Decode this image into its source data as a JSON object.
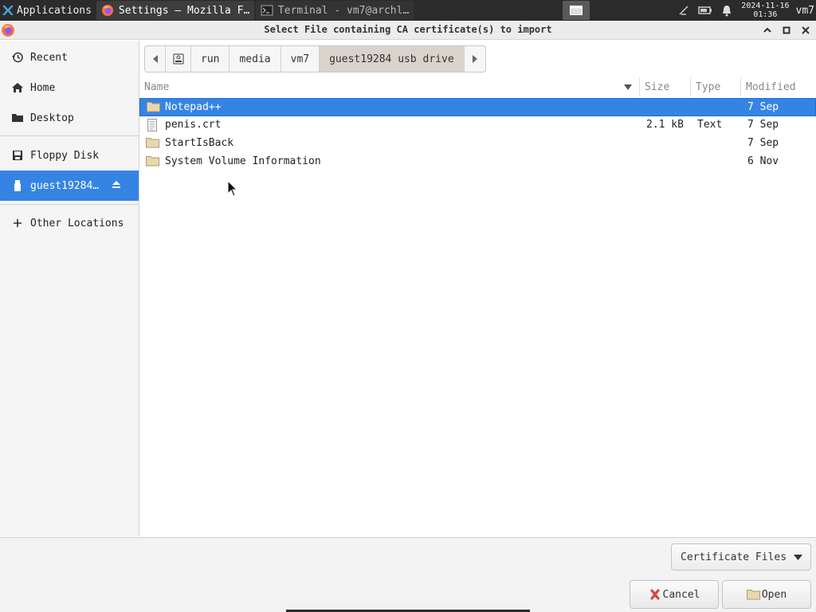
{
  "taskbar": {
    "applications_label": "Applications",
    "tasks": [
      {
        "label": "Settings — Mozilla F…",
        "icon": "firefox-icon"
      },
      {
        "label": "Terminal - vm7@archl…",
        "icon": "terminal-icon"
      }
    ],
    "clock_date": "2024-11-16",
    "clock_time": "01:36",
    "user": "vm7"
  },
  "window": {
    "title": "Select File containing CA certificate(s) to import"
  },
  "sidebar": {
    "items": [
      {
        "label": "Recent",
        "icon": "recent-icon"
      },
      {
        "label": "Home",
        "icon": "home-icon"
      },
      {
        "label": "Desktop",
        "icon": "folder-icon"
      },
      {
        "label": "Floppy Disk",
        "icon": "floppy-icon"
      },
      {
        "label": "guest19284…",
        "icon": "usb-drive-icon",
        "selected": true
      },
      {
        "label": "Other Locations",
        "icon": "plus-icon"
      }
    ]
  },
  "pathbar": {
    "segments": [
      "run",
      "media",
      "vm7",
      "guest19284 usb drive"
    ]
  },
  "columns": {
    "name": "Name",
    "size": "Size",
    "type": "Type",
    "modified": "Modified"
  },
  "files": [
    {
      "name": "Notepad++",
      "size": "",
      "type": "",
      "modified": "7 Sep",
      "kind": "folder",
      "selected": true
    },
    {
      "name": "penis.crt",
      "size": "2.1 kB",
      "type": "Text",
      "modified": "7 Sep",
      "kind": "file"
    },
    {
      "name": "StartIsBack",
      "size": "",
      "type": "",
      "modified": "7 Sep",
      "kind": "folder"
    },
    {
      "name": "System Volume Information",
      "size": "",
      "type": "",
      "modified": "6 Nov",
      "kind": "folder"
    }
  ],
  "footer": {
    "filter_label": "Certificate Files",
    "cancel_label": "Cancel",
    "open_label": "Open"
  },
  "colors": {
    "selection": "#3584e4",
    "taskbar": "#2b2b2b"
  }
}
